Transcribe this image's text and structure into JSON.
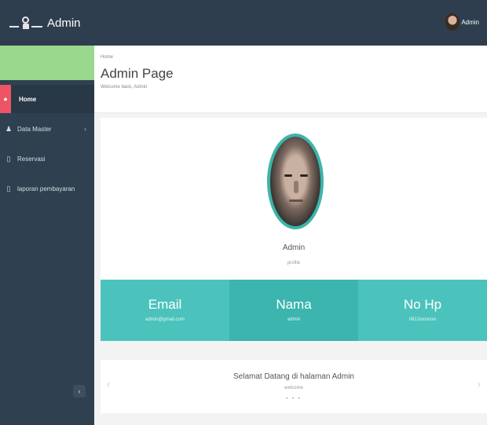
{
  "topbar": {
    "brand": "Admin",
    "user_label": "Admin"
  },
  "sidebar": {
    "items": [
      {
        "label": "Home",
        "icon": "home-icon",
        "active": true
      },
      {
        "label": "Data Master",
        "icon": "user-icon",
        "has_children": true
      },
      {
        "label": "Reservasi",
        "icon": "document-icon"
      },
      {
        "label": "laporan pembayaran",
        "icon": "document-icon"
      }
    ],
    "collapse_icon": "chevron-left-icon"
  },
  "page_heading": {
    "breadcrumb": "Home",
    "title": "Admin Page",
    "subtitle": "Welcome back, Admin"
  },
  "profile": {
    "name": "Admin",
    "role": "profile"
  },
  "stats": [
    {
      "label": "Email",
      "value": "admin@gmail.com"
    },
    {
      "label": "Nama",
      "value": "admin"
    },
    {
      "label": "No Hp",
      "value": "0812xxxxxxx"
    }
  ],
  "slider": {
    "title": "Selamat Datang di halaman Admin",
    "subtitle": "welcome",
    "dots": "• • •"
  },
  "colors": {
    "topbar": "#2f3e4f",
    "sidebar": "#2f4050",
    "accent_teal": "#4bc3bc",
    "active_red": "#ed5565",
    "sidebar_header": "#9ad88d"
  }
}
